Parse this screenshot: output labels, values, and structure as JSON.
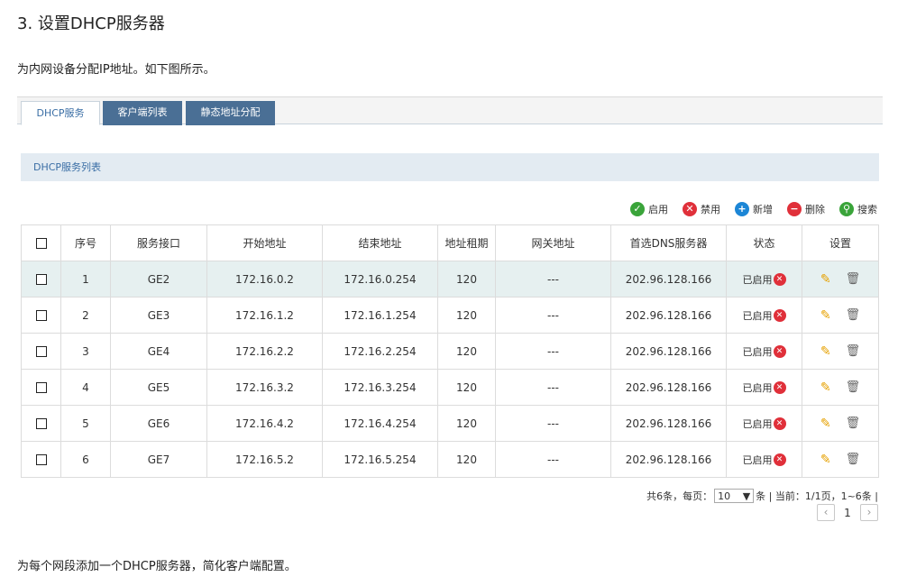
{
  "heading": "3. 设置DHCP服务器",
  "intro": "为内网设备分配IP地址。如下图所示。",
  "outro": "为每个网段添加一个DHCP服务器，简化客户端配置。",
  "tabs": [
    {
      "label": "DHCP服务",
      "active": true
    },
    {
      "label": "客户端列表",
      "active": false
    },
    {
      "label": "静态地址分配",
      "active": false
    }
  ],
  "section_title": "DHCP服务列表",
  "toolbar": [
    {
      "label": "启用",
      "icon": "check-circle-icon",
      "color": "#3aa43a"
    },
    {
      "label": "禁用",
      "icon": "x-circle-icon",
      "color": "#e0303a"
    },
    {
      "label": "新增",
      "icon": "plus-circle-icon",
      "color": "#1c86d6"
    },
    {
      "label": "删除",
      "icon": "minus-circle-icon",
      "color": "#e0303a"
    },
    {
      "label": "搜索",
      "icon": "search-circle-icon",
      "color": "#3aa43a"
    }
  ],
  "table": {
    "headers": [
      "序号",
      "服务接口",
      "开始地址",
      "结束地址",
      "地址租期",
      "网关地址",
      "首选DNS服务器",
      "状态",
      "设置"
    ],
    "rows": [
      {
        "no": "1",
        "iface": "GE2",
        "start": "172.16.0.2",
        "end": "172.16.0.254",
        "lease": "120",
        "gw": "---",
        "dns": "202.96.128.166",
        "status": "已启用"
      },
      {
        "no": "2",
        "iface": "GE3",
        "start": "172.16.1.2",
        "end": "172.16.1.254",
        "lease": "120",
        "gw": "---",
        "dns": "202.96.128.166",
        "status": "已启用"
      },
      {
        "no": "3",
        "iface": "GE4",
        "start": "172.16.2.2",
        "end": "172.16.2.254",
        "lease": "120",
        "gw": "---",
        "dns": "202.96.128.166",
        "status": "已启用"
      },
      {
        "no": "4",
        "iface": "GE5",
        "start": "172.16.3.2",
        "end": "172.16.3.254",
        "lease": "120",
        "gw": "---",
        "dns": "202.96.128.166",
        "status": "已启用"
      },
      {
        "no": "5",
        "iface": "GE6",
        "start": "172.16.4.2",
        "end": "172.16.4.254",
        "lease": "120",
        "gw": "---",
        "dns": "202.96.128.166",
        "status": "已启用"
      },
      {
        "no": "6",
        "iface": "GE7",
        "start": "172.16.5.2",
        "end": "172.16.5.254",
        "lease": "120",
        "gw": "---",
        "dns": "202.96.128.166",
        "status": "已启用"
      }
    ]
  },
  "pager": {
    "total_text": "共6条，每页：",
    "per_page": "10",
    "mid_text": "条 | 当前：1/1页，1~6条 |",
    "current_page": "1",
    "prev": "‹",
    "next": "›"
  }
}
